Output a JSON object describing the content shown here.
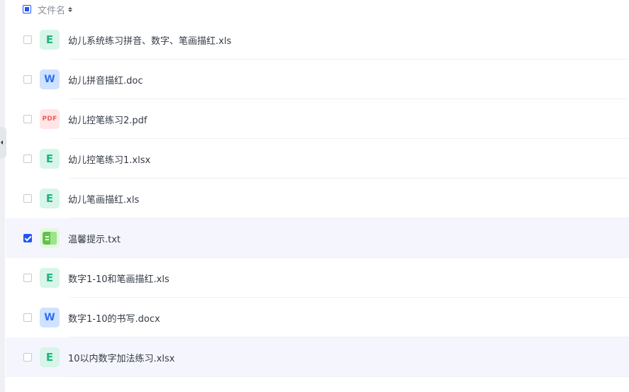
{
  "header": {
    "column_label": "文件名",
    "select_all_state": "indeterminate"
  },
  "files": [
    {
      "name": "幼儿系统练习拼音、数字、笔画描红.xls",
      "icon": "excel-icon",
      "icon_text": "E",
      "selected": false
    },
    {
      "name": "幼儿拼音描红.doc",
      "icon": "word-icon",
      "icon_text": "W",
      "selected": false
    },
    {
      "name": "幼儿控笔练习2.pdf",
      "icon": "pdf-icon",
      "icon_text": "PDF",
      "selected": false
    },
    {
      "name": "幼儿控笔练习1.xlsx",
      "icon": "excel-icon",
      "icon_text": "E",
      "selected": false
    },
    {
      "name": "幼儿笔画描红.xls",
      "icon": "excel-icon",
      "icon_text": "E",
      "selected": false
    },
    {
      "name": "温馨提示.txt",
      "icon": "txt-icon",
      "icon_text": "",
      "selected": true
    },
    {
      "name": "数字1-10和笔画描红.xls",
      "icon": "excel-icon",
      "icon_text": "E",
      "selected": false
    },
    {
      "name": "数字1-10的书写.docx",
      "icon": "word-icon",
      "icon_text": "W",
      "selected": false
    },
    {
      "name": "10以内数字加法练习.xlsx",
      "icon": "excel-icon",
      "icon_text": "E",
      "selected": false
    }
  ],
  "colors": {
    "accent": "#2254f4",
    "excel": "#1fb57e",
    "word": "#2e6ff2",
    "pdf": "#ee5c5c",
    "txt": "#5fc34a",
    "row_highlight": "#f5f6fd"
  }
}
